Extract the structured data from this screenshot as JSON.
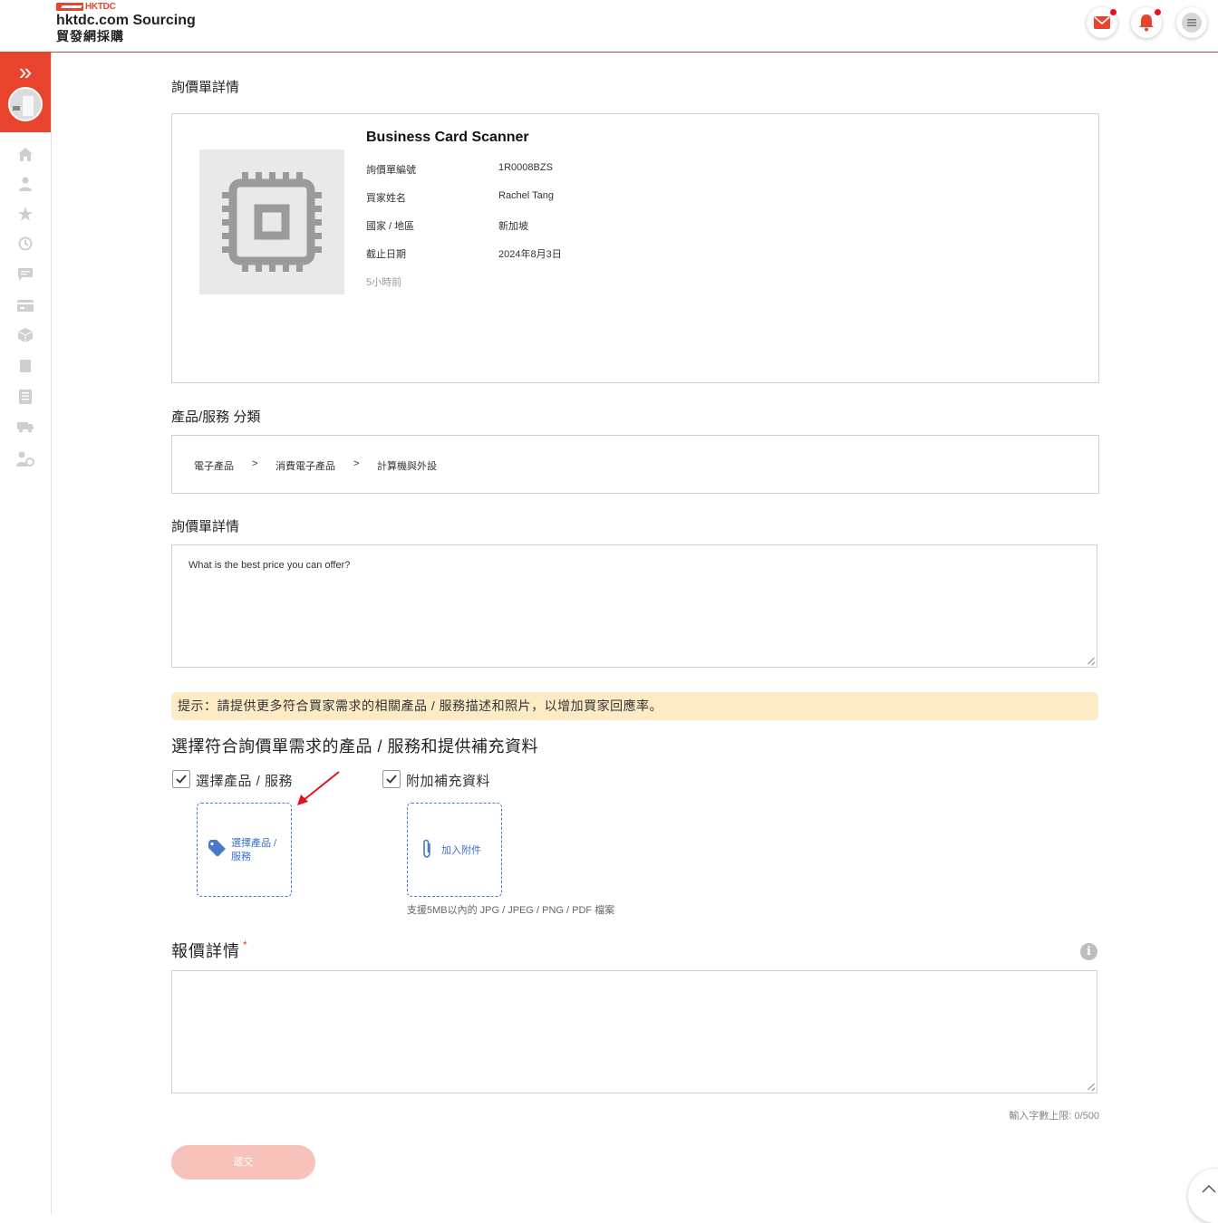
{
  "header": {
    "logo_small": "HKTDC",
    "logo_en": "hktdc.com Sourcing",
    "logo_zh": "貿發網採購",
    "icons": [
      "mail-icon",
      "bell-icon",
      "menu-icon"
    ],
    "accent_color": "#e8432c"
  },
  "sidebar": {
    "expand_glyph": "»",
    "icons": [
      "home-icon",
      "user-icon",
      "star-icon",
      "history-icon",
      "chat-icon",
      "card-icon",
      "box-icon",
      "book-icon",
      "list-icon",
      "truck-icon",
      "user-settings-icon"
    ]
  },
  "rfq": {
    "section_title": "詢價單詳情",
    "product_title": "Business Card Scanner",
    "rows": [
      {
        "label": "詢價單編號",
        "value": "1R0008BZS"
      },
      {
        "label": "買家姓名",
        "value": "Rachel Tang"
      },
      {
        "label": "國家 / 地區",
        "value": "新加坡"
      },
      {
        "label": "截止日期",
        "value": "2024年8月3日"
      }
    ],
    "posted_ago": "5小時前"
  },
  "category": {
    "title": "產品/服務 分類",
    "crumbs": [
      "電子產品",
      "消費電子產品",
      "計算機與外設"
    ],
    "separator": ">"
  },
  "detail": {
    "title": "詢價單詳情",
    "text": "What is the best price you can offer?"
  },
  "tip": {
    "text": "提示：請提供更多符合買家需求的相關產品 / 服務描述和照片，以增加買家回應率。"
  },
  "selection": {
    "title": "選擇符合詢價單需求的產品 / 服務和提供補充資料",
    "option_product": "選擇產品 / 服務",
    "option_attach": "附加補充資料",
    "select_product_line1": "選擇產品 /",
    "select_product_line2": "服務",
    "add_attachment": "加入附件",
    "support_text": "支援5MB以內的 JPG / JPEG / PNG / PDF 檔案"
  },
  "quote": {
    "title": "報價詳情",
    "required_mark": "*",
    "info_glyph": "i",
    "counter": "輸入字數上限: 0/500",
    "submit": "遞交"
  }
}
